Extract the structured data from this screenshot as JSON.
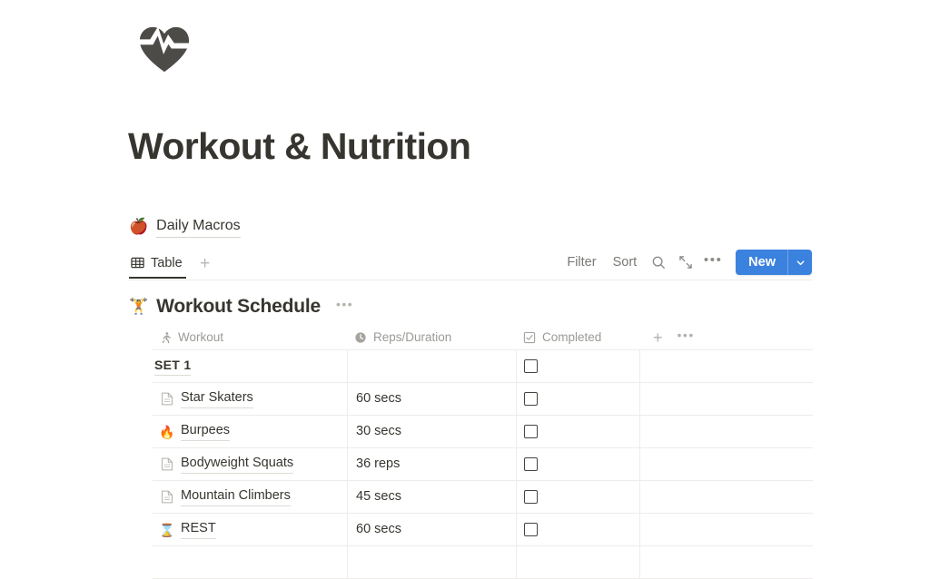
{
  "page": {
    "icon": "heart-pulse-icon",
    "title": "Workout & Nutrition"
  },
  "macros_link": {
    "emoji": "🍎",
    "emoji_name": "apple-emoji",
    "label": "Daily Macros"
  },
  "view_bar": {
    "tab": {
      "icon": "table-icon",
      "label": "Table"
    },
    "add_view_label": "+",
    "actions": {
      "filter_label": "Filter",
      "sort_label": "Sort",
      "search_icon": "search-icon",
      "collapse_icon": "collapse-arrows-icon",
      "more_label": "•••",
      "new_label": "New",
      "new_caret_icon": "chevron-down-icon",
      "new_color": "#3b82df"
    }
  },
  "database": {
    "emoji": "🏋",
    "emoji_name": "dumbbell-emoji",
    "title": "Workout Schedule",
    "more_label": "•••",
    "columns": [
      {
        "icon": "running-person-icon",
        "label": "Workout"
      },
      {
        "icon": "clock-icon",
        "label": "Reps/Duration"
      },
      {
        "icon": "checkbox-icon",
        "label": "Completed"
      }
    ],
    "header_add_label": "+",
    "header_more_label": "•••",
    "rows": [
      {
        "emoji": "",
        "icon": "",
        "name": "SET 1",
        "reps": "",
        "completed": false,
        "is_group": true
      },
      {
        "emoji": "",
        "icon": "page-icon",
        "name": "Star Skaters",
        "reps": "60 secs",
        "completed": false,
        "is_group": false
      },
      {
        "emoji": "🔥",
        "icon": "fire-emoji",
        "name": "Burpees",
        "reps": "30 secs",
        "completed": false,
        "is_group": false
      },
      {
        "emoji": "",
        "icon": "page-icon",
        "name": "Bodyweight Squats",
        "reps": "36 reps",
        "completed": false,
        "is_group": false
      },
      {
        "emoji": "",
        "icon": "page-icon",
        "name": "Mountain Climbers",
        "reps": "45 secs",
        "completed": false,
        "is_group": false
      },
      {
        "emoji": "⌛",
        "icon": "hourglass-emoji",
        "name": "REST",
        "reps": "60 secs",
        "completed": false,
        "is_group": false
      }
    ]
  }
}
